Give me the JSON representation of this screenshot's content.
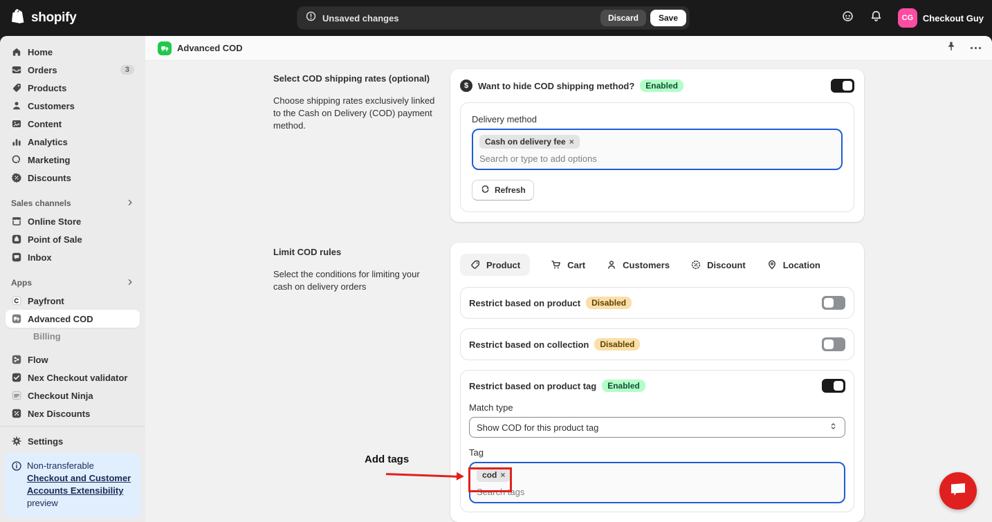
{
  "ui": {
    "close_glyph": "×",
    "currency_glyph": "$"
  },
  "topbar": {
    "logo_text": "shopify",
    "save_bar": {
      "status": "Unsaved changes",
      "discard_label": "Discard",
      "save_label": "Save"
    },
    "user": {
      "initials": "CG",
      "name": "Checkout Guy"
    }
  },
  "sidebar": {
    "items": [
      {
        "label": "Home"
      },
      {
        "label": "Orders",
        "badge": "3"
      },
      {
        "label": "Products"
      },
      {
        "label": "Customers"
      },
      {
        "label": "Content"
      },
      {
        "label": "Analytics"
      },
      {
        "label": "Marketing"
      },
      {
        "label": "Discounts"
      }
    ],
    "sales_channels_label": "Sales channels",
    "channels": [
      {
        "label": "Online Store"
      },
      {
        "label": "Point of Sale"
      },
      {
        "label": "Inbox"
      }
    ],
    "apps_label": "Apps",
    "apps": [
      {
        "label": "Payfront"
      },
      {
        "label": "Advanced COD",
        "selected": true
      },
      {
        "label": "Billing"
      },
      {
        "label": "Flow"
      },
      {
        "label": "Nex Checkout validator"
      },
      {
        "label": "Checkout Ninja"
      },
      {
        "label": "Nex Discounts"
      }
    ],
    "settings_label": "Settings",
    "notice": {
      "prefix": "Non-transferable",
      "link_text": "Checkout and Customer Accounts Extensibility",
      "suffix": "preview"
    }
  },
  "app_header": {
    "title": "Advanced COD"
  },
  "shipping_section": {
    "heading": "Select COD shipping rates (optional)",
    "description": "Choose shipping rates exclusively linked to the Cash on Delivery (COD) payment method.",
    "card": {
      "question": "Want to hide COD shipping method?",
      "status_badge": "Enabled",
      "field_label": "Delivery method",
      "selected_option": "Cash on delivery fee",
      "placeholder": "Search or type to add options",
      "refresh_label": "Refresh"
    }
  },
  "rules_section": {
    "heading": "Limit COD rules",
    "description": "Select the conditions for limiting your cash on delivery orders",
    "tabs": [
      {
        "label": "Product",
        "selected": true
      },
      {
        "label": "Cart",
        "selected": false
      },
      {
        "label": "Customers",
        "selected": false
      },
      {
        "label": "Discount",
        "selected": false
      },
      {
        "label": "Location",
        "selected": false
      }
    ],
    "rules": [
      {
        "label": "Restrict based on product",
        "badge": "Disabled",
        "enabled": false
      },
      {
        "label": "Restrict based on collection",
        "badge": "Disabled",
        "enabled": false
      },
      {
        "label": "Restrict based on product tag",
        "badge": "Enabled",
        "enabled": true
      }
    ],
    "match_type": {
      "label": "Match type",
      "value": "Show COD for this product tag"
    },
    "tag_field": {
      "label": "Tag",
      "chip": "cod",
      "placeholder": "Search tags"
    }
  },
  "annotation": {
    "label": "Add tags"
  },
  "colors": {
    "topbar_bg": "#1a1a1a",
    "sidebar_bg": "#ebebeb",
    "content_bg": "#f1f1f1",
    "focus_blue": "#1e5ed6",
    "success_badge_bg": "#b3fdc8",
    "success_badge_text": "#0c5132",
    "caution_badge_bg": "#fbdfa9",
    "caution_badge_text": "#5e4200",
    "annotation_red": "#e0211c",
    "avatar_pink": "#fb4da1",
    "app_icon_green": "#1fc94e",
    "chat_fab_red": "#e0201e",
    "notice_bg": "#e0eefd",
    "notice_text": "#1a2b55"
  }
}
